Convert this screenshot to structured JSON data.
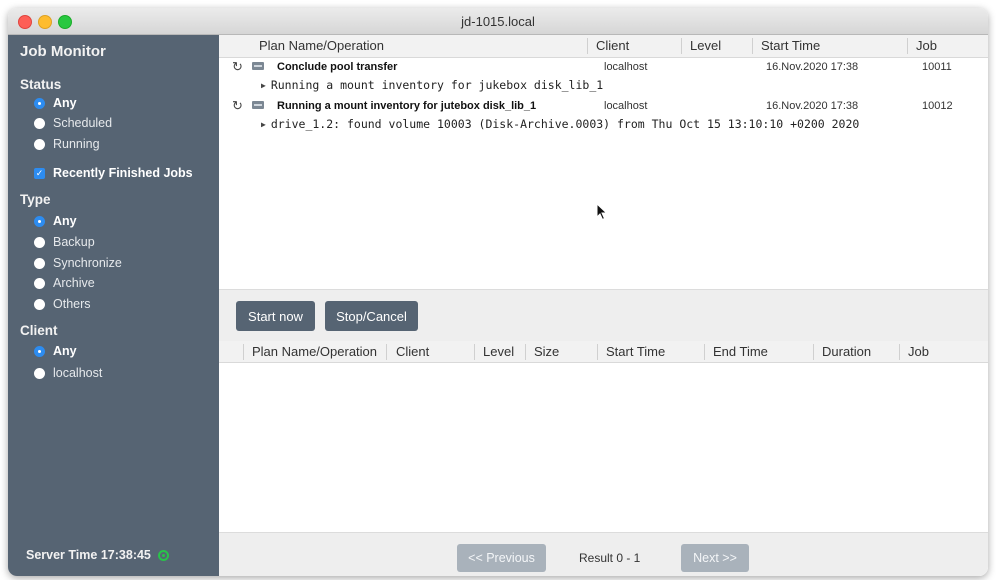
{
  "window": {
    "title": "jd-1015.local"
  },
  "sidebar": {
    "title": "Job Monitor",
    "status": {
      "label": "Status",
      "options": [
        "Any",
        "Scheduled",
        "Running"
      ],
      "selected": "Any"
    },
    "recently_finished": {
      "label": "Recently Finished Jobs",
      "checked": true
    },
    "type": {
      "label": "Type",
      "options": [
        "Any",
        "Backup",
        "Synchronize",
        "Archive",
        "Others"
      ],
      "selected": "Any"
    },
    "client": {
      "label": "Client",
      "options": [
        "Any",
        "localhost"
      ],
      "selected": "Any"
    },
    "server_time": {
      "label": "Server Time",
      "value": "17:38:45",
      "status_color": "#29c24a"
    }
  },
  "running_table": {
    "columns": [
      "Plan Name/Operation",
      "Client",
      "Level",
      "Start Time",
      "Job"
    ],
    "rows": [
      {
        "name": "Conclude pool transfer",
        "client": "localhost",
        "level": "",
        "start_time": "16.Nov.2020 17:38",
        "job": "10011",
        "detail": "Running a mount inventory for jukebox disk_lib_1"
      },
      {
        "name": "Running a mount inventory for jutebox disk_lib_1",
        "client": "localhost",
        "level": "",
        "start_time": "16.Nov.2020 17:38",
        "job": "10012",
        "detail": "drive_1.2: found volume 10003 (Disk-Archive.0003) from Thu Oct 15 13:10:10 +0200 2020"
      }
    ]
  },
  "actions": {
    "start_now": "Start now",
    "stop_cancel": "Stop/Cancel"
  },
  "finished_table": {
    "columns": [
      "Plan Name/Operation",
      "Client",
      "Level",
      "Size",
      "Start Time",
      "End Time",
      "Duration",
      "Job"
    ],
    "rows": []
  },
  "pagination": {
    "previous": "<< Previous",
    "result": "Result 0 - 1",
    "next": "Next >>"
  },
  "colors": {
    "sidebar": "#566473",
    "accent": "#2d8cf0",
    "button": "#566473",
    "button_disabled": "#a9b2bb"
  }
}
